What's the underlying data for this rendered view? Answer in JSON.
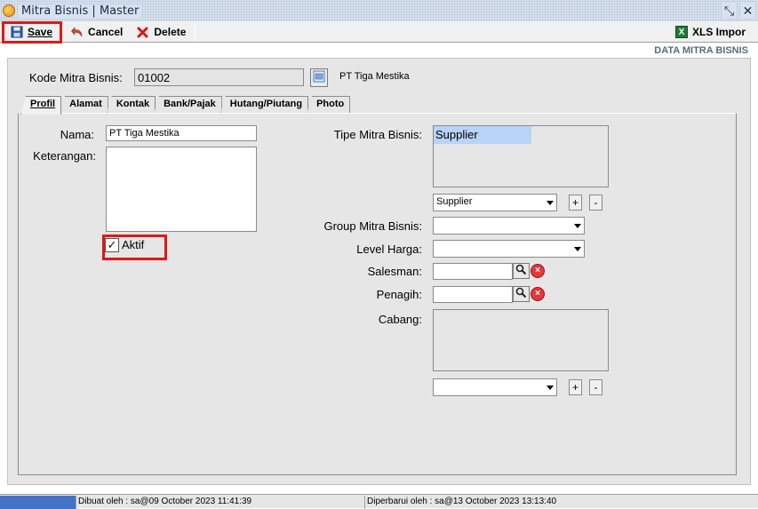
{
  "window": {
    "title": "Mitra Bisnis | Master",
    "restore_glyph": "⤡",
    "close_glyph": "✕",
    "icons": {
      "app": "app-icon",
      "restore": "restore-icon",
      "close": "close-icon"
    }
  },
  "toolbar": {
    "save_label": "Save",
    "cancel_label": "Cancel",
    "delete_label": "Delete",
    "xls_label": "XLS Impor",
    "xls_icon_text": "X",
    "icons": {
      "save": "save-icon",
      "cancel": "undo-icon",
      "delete": "delete-icon",
      "xls": "excel-icon"
    },
    "highlight_color": "#e01818"
  },
  "header": {
    "section_title": "DATA MITRA BISNIS",
    "kode_label": "Kode Mitra Bisnis:",
    "kode_value": "01002",
    "company_name": "PT Tiga Mestika"
  },
  "tabs": [
    {
      "label": "Profil",
      "active": true
    },
    {
      "label": "Alamat",
      "active": false
    },
    {
      "label": "Kontak",
      "active": false
    },
    {
      "label": "Bank/Pajak",
      "active": false
    },
    {
      "label": "Hutang/Piutang",
      "active": false
    },
    {
      "label": "Photo",
      "active": false
    }
  ],
  "profil": {
    "nama_label": "Nama:",
    "nama_value": "PT Tiga Mestika",
    "keterangan_label": "Keterangan:",
    "keterangan_value": "",
    "aktif_label": "Aktif",
    "aktif_checked": true,
    "aktif_check_glyph": "✓"
  },
  "right_form": {
    "tipe_label": "Tipe Mitra Bisnis:",
    "tipe_list": [
      "Supplier"
    ],
    "tipe_selected": "Supplier",
    "tipe_combo_value": "Supplier",
    "group_label": "Group Mitra Bisnis:",
    "group_value": "",
    "level_label": "Level Harga:",
    "level_value": "",
    "salesman_label": "Salesman:",
    "salesman_value": "",
    "penagih_label": "Penagih:",
    "penagih_value": "",
    "cabang_label": "Cabang:",
    "cabang_combo_value": "",
    "plus_label": "+",
    "minus_label": "-",
    "clear_glyph": "×",
    "icons": {
      "search": "magnifier-icon",
      "clear": "clear-icon",
      "browse": "browse-icon"
    }
  },
  "status": {
    "created": "Dibuat oleh : sa@09 October 2023  11:41:39",
    "updated": "Diperbarui oleh : sa@13 October 2023  13:13:40"
  },
  "colors": {
    "selection": "#b7d3f5",
    "status_accent": "#4472c4",
    "highlight": "#e01818"
  }
}
